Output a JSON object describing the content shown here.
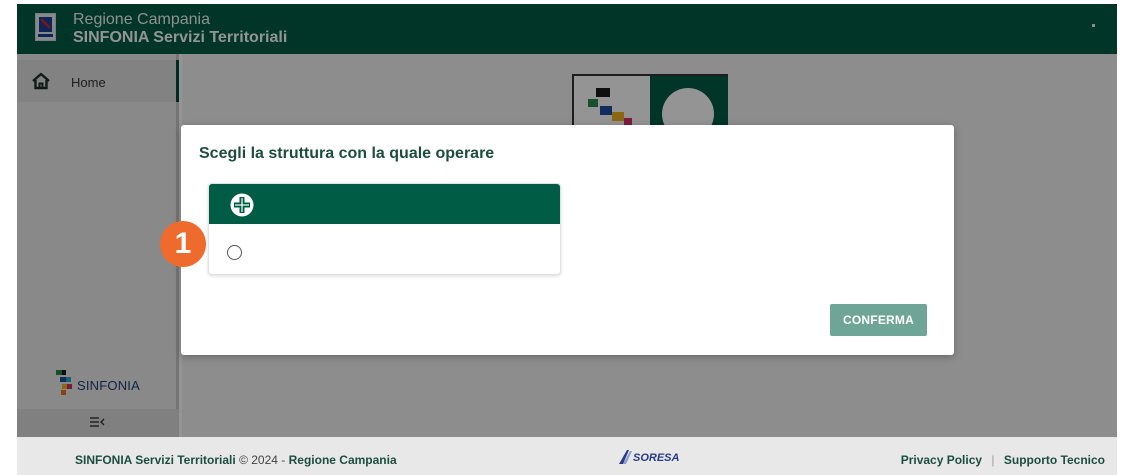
{
  "header": {
    "region": "Regione Campania",
    "app_title": "SINFONIA Servizi Territoriali",
    "user_caret": "▾"
  },
  "sidebar": {
    "items": [
      {
        "label": "Home",
        "icon": "home-icon",
        "active": true
      }
    ],
    "brand": "SINFONIA",
    "collapse_icon": "collapse-sidebar-icon"
  },
  "modal": {
    "title": "Scegli la struttura con la quale operare",
    "card": {
      "header_icon": "health-cross-icon",
      "selected": false
    },
    "confirm_label": "CONFERMA"
  },
  "badge": {
    "number": "1",
    "color": "#ef6a2d"
  },
  "footer": {
    "app": "SINFONIA Servizi Territoriali",
    "copyright": "© 2024 -",
    "org": "Regione Campania",
    "partner_logo": "SORESA",
    "privacy": "Privacy Policy",
    "separator": "|",
    "support": "Supporto Tecnico"
  },
  "colors": {
    "brand_green": "#005c45",
    "button_green": "#6fa596",
    "badge_orange": "#ef6a2d"
  }
}
